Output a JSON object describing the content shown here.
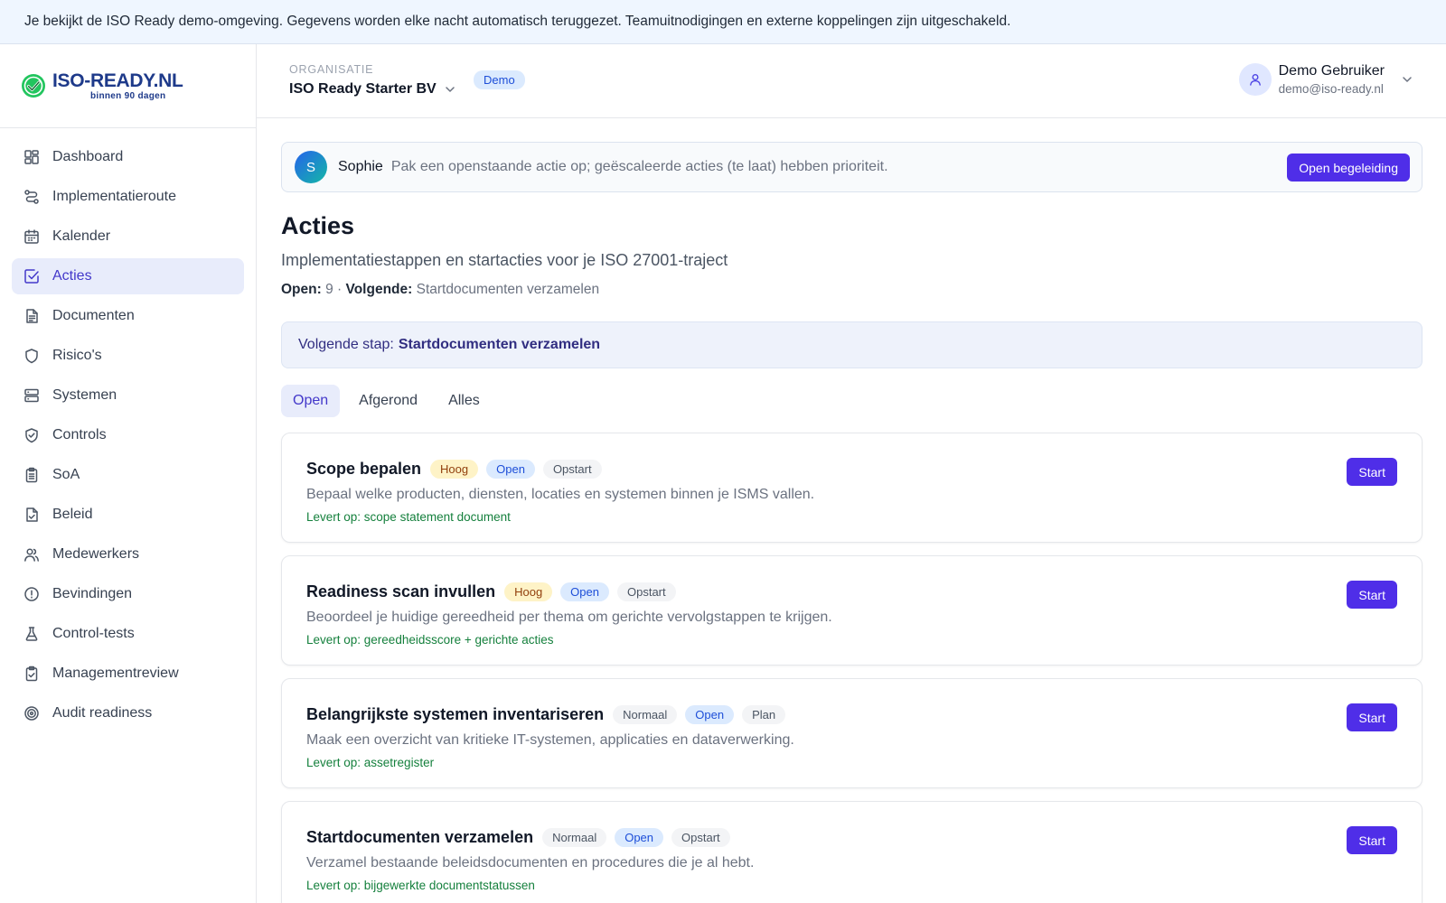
{
  "banner": {
    "text": "Je bekijkt de ISO Ready demo-omgeving. Gegevens worden elke nacht automatisch teruggezet. Teamuitnodigingen en externe koppelingen zijn uitgeschakeld."
  },
  "logo": {
    "title": "ISO-READY.NL",
    "subtitle": "binnen 90 dagen"
  },
  "sidebar": {
    "items": [
      {
        "label": "Dashboard",
        "icon": "dashboard-icon"
      },
      {
        "label": "Implementatieroute",
        "icon": "route-icon"
      },
      {
        "label": "Kalender",
        "icon": "calendar-icon"
      },
      {
        "label": "Acties",
        "icon": "check-square-icon",
        "active": true
      },
      {
        "label": "Documenten",
        "icon": "document-icon"
      },
      {
        "label": "Risico's",
        "icon": "shield-icon"
      },
      {
        "label": "Systemen",
        "icon": "server-icon"
      },
      {
        "label": "Controls",
        "icon": "shield-check-icon"
      },
      {
        "label": "SoA",
        "icon": "clipboard-list-icon"
      },
      {
        "label": "Beleid",
        "icon": "file-check-icon"
      },
      {
        "label": "Medewerkers",
        "icon": "users-icon"
      },
      {
        "label": "Bevindingen",
        "icon": "alert-circle-icon"
      },
      {
        "label": "Control-tests",
        "icon": "flask-icon"
      },
      {
        "label": "Managementreview",
        "icon": "clipboard-check-icon"
      },
      {
        "label": "Audit readiness",
        "icon": "target-icon"
      }
    ]
  },
  "header": {
    "org_label": "ORGANISATIE",
    "org_name": "ISO Ready Starter BV",
    "badge": "Demo",
    "user_name": "Demo Gebruiker",
    "user_email": "demo@iso-ready.nl"
  },
  "assistant": {
    "avatar_letter": "S",
    "name": "Sophie",
    "message": "Pak een openstaande actie op; geëscaleerde acties (te laat) hebben prioriteit.",
    "button": "Open begeleiding"
  },
  "page": {
    "title": "Acties",
    "subtitle": "Implementatiestappen en startacties voor je ISO 27001-traject",
    "open_label": "Open:",
    "open_count": "9",
    "separator": "·",
    "next_label": "Volgende:",
    "next_value": "Startdocumenten verzamelen"
  },
  "next_step": {
    "label": "Volgende stap:",
    "value": "Startdocumenten verzamelen"
  },
  "tabs": [
    {
      "label": "Open",
      "active": true
    },
    {
      "label": "Afgerond"
    },
    {
      "label": "Alles"
    }
  ],
  "actions": [
    {
      "title": "Scope bepalen",
      "priority": "Hoog",
      "priority_type": "hoog",
      "status": "Open",
      "phase": "Opstart",
      "description": "Bepaal welke producten, diensten, locaties en systemen binnen je ISMS vallen.",
      "deliverable": "Levert op: scope statement document",
      "button": "Start"
    },
    {
      "title": "Readiness scan invullen",
      "priority": "Hoog",
      "priority_type": "hoog",
      "status": "Open",
      "phase": "Opstart",
      "description": "Beoordeel je huidige gereedheid per thema om gerichte vervolgstappen te krijgen.",
      "deliverable": "Levert op: gereedheidsscore + gerichte acties",
      "button": "Start"
    },
    {
      "title": "Belangrijkste systemen inventariseren",
      "priority": "Normaal",
      "priority_type": "normaal",
      "status": "Open",
      "phase": "Plan",
      "description": "Maak een overzicht van kritieke IT-systemen, applicaties en dataverwerking.",
      "deliverable": "Levert op: assetregister",
      "button": "Start"
    },
    {
      "title": "Startdocumenten verzamelen",
      "priority": "Normaal",
      "priority_type": "normaal",
      "status": "Open",
      "phase": "Opstart",
      "description": "Verzamel bestaande beleidsdocumenten en procedures die je al hebt.",
      "deliverable": "Levert op: bijgewerkte documentstatussen",
      "button": "Start"
    }
  ]
}
